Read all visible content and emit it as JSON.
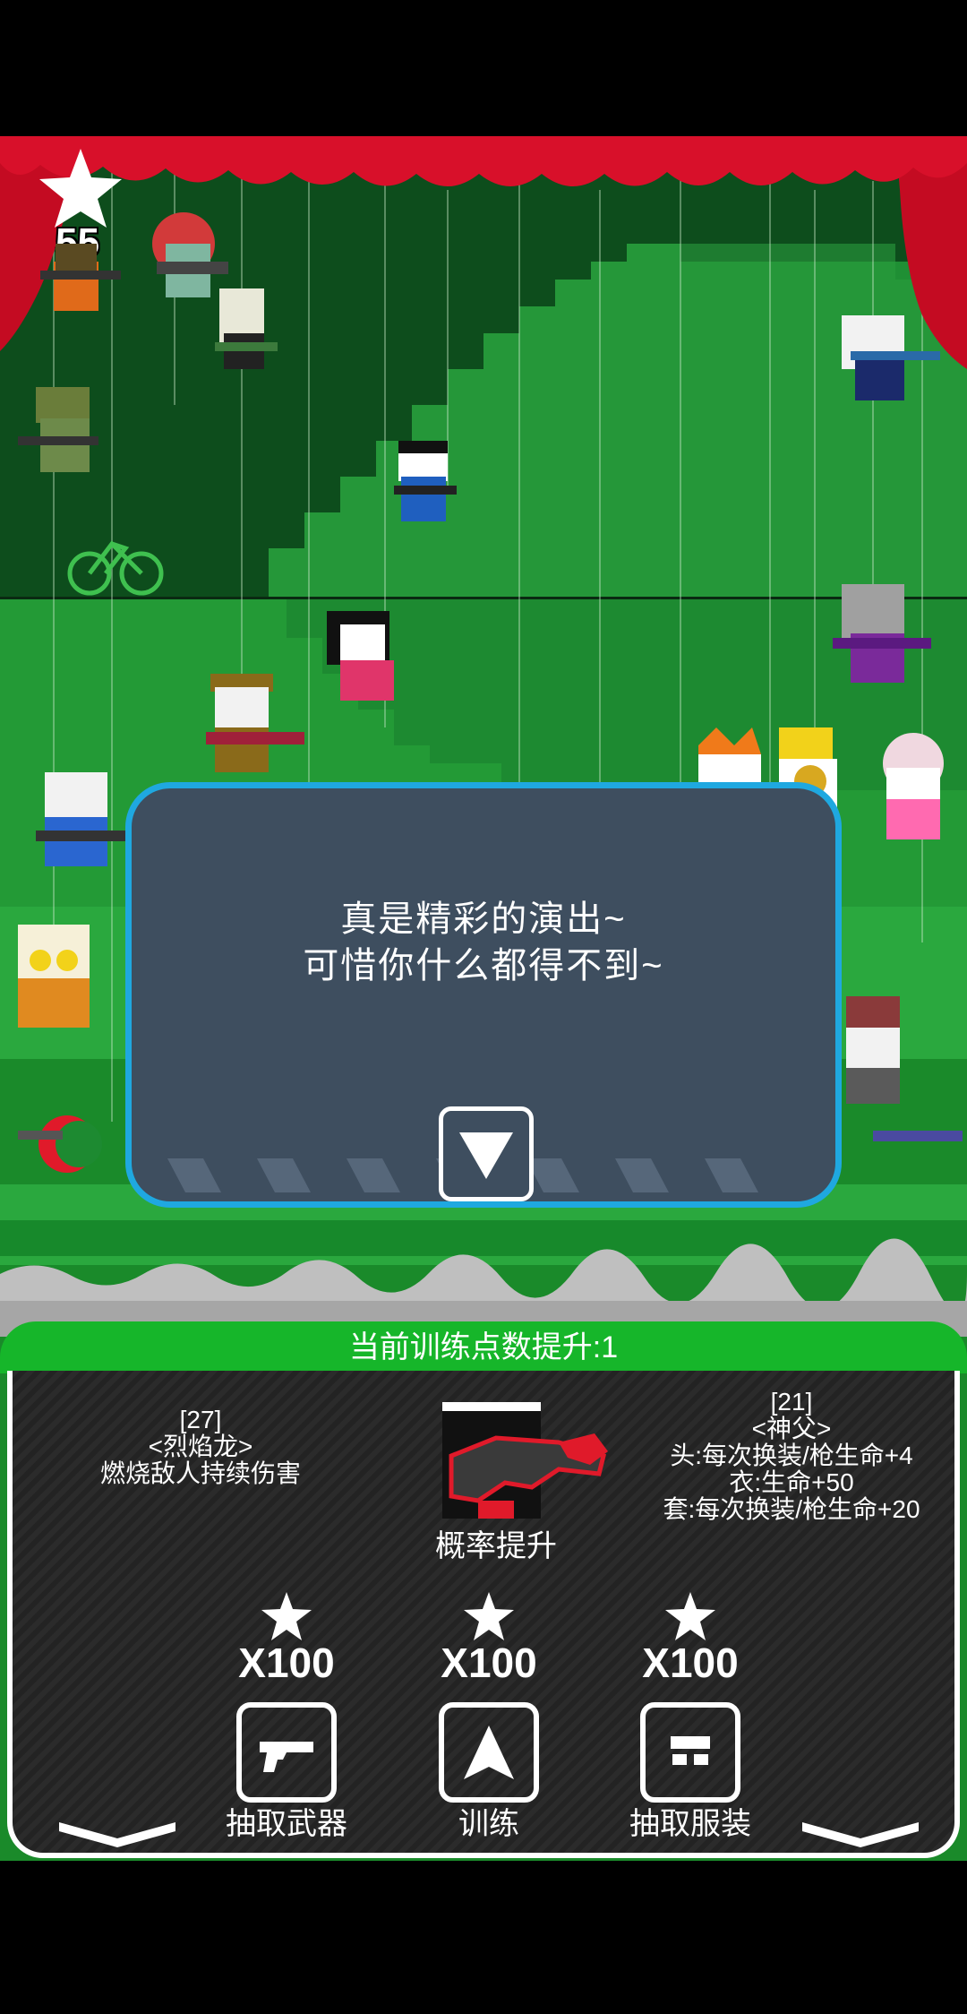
{
  "hud": {
    "star_count": "55"
  },
  "dialog": {
    "lines": [
      "真是精彩的演出~",
      "可惜你什么都得不到~"
    ],
    "next_icon": "down-arrow-icon"
  },
  "panel": {
    "header": "当前训练点数提升:1",
    "left_info": {
      "level": "[27]",
      "name": "<烈焰龙>",
      "desc": "燃烧敌人持续伤害"
    },
    "right_info": {
      "level": "[21]",
      "name": "<神父>",
      "head": "头:每次换装/枪生命+4",
      "body": "衣:生命+50",
      "set": "套:每次换装/枪生命+20"
    },
    "center_label": "概率提升",
    "actions": [
      {
        "cost": "X100",
        "label": "抽取武器",
        "icon": "revolver-icon"
      },
      {
        "cost": "X100",
        "label": "训练",
        "icon": "up-arrow-icon"
      },
      {
        "cost": "X100",
        "label": "抽取服装",
        "icon": "outfit-icon"
      }
    ]
  },
  "colors": {
    "accent_green": "#16b62a",
    "dialog_bg": "#3e4e5f",
    "dialog_border": "#1fa8e0",
    "curtain_red": "#d8102a"
  }
}
